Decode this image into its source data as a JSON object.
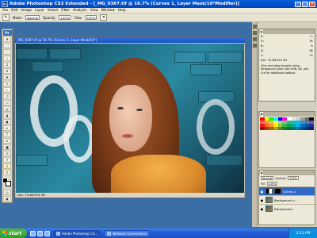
{
  "window": {
    "title": "Adobe Photoshop CS3 Extended - [_MG_0367.tif @ 16.7% (Curves 1, Layer Mask/16*Modifier)]",
    "logo": "Ps"
  },
  "menu": [
    "File",
    "Edit",
    "Image",
    "Layer",
    "Select",
    "Filter",
    "Analysis",
    "View",
    "Window",
    "Help"
  ],
  "options": {
    "mode_label": "Mode:",
    "mode_value": "Normal",
    "opacity_label": "Opacity:",
    "opacity_value": "100%",
    "flow_label": "Flow:",
    "flow_value": "100%"
  },
  "toolbox": {
    "logo": "Ps"
  },
  "document": {
    "title": "_MG_0367.tif @ 16.7% (Curves 1, Layer Mask/16*)",
    "status": "Doc: 70.4M/154.3M"
  },
  "info_panel": {
    "rows": [
      {
        "left": "R:",
        "right": "C:"
      },
      {
        "left": "G:",
        "right": "M:"
      },
      {
        "left": "B:",
        "right": "Y:"
      },
      {
        "left": "X:",
        "right": "W:"
      },
      {
        "left": "Y:",
        "right": "H:"
      }
    ],
    "doc": "Doc: 70.4M/154.3M",
    "hint": "Click and drag to paint using foreground color. Use Shift, Alt, and Ctrl for additional options."
  },
  "swatches": {
    "colors": [
      "#ff0000",
      "#ffff00",
      "#00ff00",
      "#00ffff",
      "#0000ff",
      "#ff00ff",
      "#ffffff",
      "#e6e6e6",
      "#cccccc",
      "#999999",
      "#666666",
      "#000000",
      "#f26c4f",
      "#f68e55",
      "#fbaf5d",
      "#fff467",
      "#acd372",
      "#7cc576",
      "#3bb878",
      "#1abbb4",
      "#00bff3",
      "#438ccb",
      "#5574b9",
      "#605ca8",
      "#ed1c24",
      "#f26522",
      "#f7941d",
      "#fff200",
      "#8dc63f",
      "#39b54a",
      "#00a651",
      "#00a99d",
      "#00aeef",
      "#0072bc",
      "#0054a6",
      "#2e3192",
      "#9e0b0f",
      "#a0410d",
      "#a3620a",
      "#aba000",
      "#598527",
      "#1a7b30",
      "#007236",
      "#00746b",
      "#0076a3",
      "#004b80",
      "#003471",
      "#1b1464"
    ]
  },
  "layers": {
    "blend_mode": "Normal",
    "opacity_label": "Opacity:",
    "opacity_value": "100%",
    "fill_label": "Fill:",
    "fill_value": "100%",
    "items": [
      {
        "name": "Curves 1",
        "selected": true
      },
      {
        "name": "Background c...",
        "selected": false
      },
      {
        "name": "Background",
        "selected": false
      }
    ]
  },
  "taskbar": {
    "start": "start",
    "tasks": [
      {
        "label": "Adobe Photoshop CS...",
        "active": true
      },
      {
        "label": "Network Connections",
        "active": false
      }
    ],
    "clock": "2:23 PM"
  }
}
